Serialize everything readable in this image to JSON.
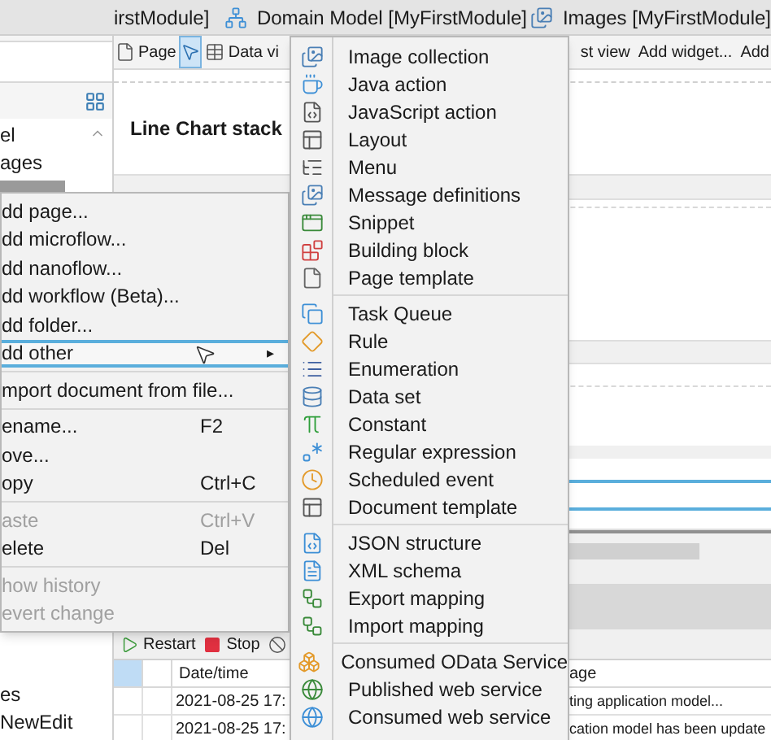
{
  "tabs": [
    {
      "label": "irstModule]",
      "kind": "page",
      "selected": false
    },
    {
      "label": "Domain Model [MyFirstModule]",
      "kind": "domain_model",
      "selected": false
    },
    {
      "label": "Images [MyFirstModule]",
      "kind": "images",
      "selected": false
    }
  ],
  "sidebar": {
    "items": [
      "el",
      "ages"
    ],
    "bottom_items": [
      "es",
      "NewEdit"
    ]
  },
  "toolbar": {
    "items": [
      {
        "label": "Page",
        "kind": "page",
        "selected": false
      },
      {
        "kind": "pointer",
        "selected": true
      },
      {
        "label": "Data vi",
        "kind": "data_view",
        "selected": false
      },
      {
        "label": "st view",
        "kind": "text",
        "selected": false
      },
      {
        "label": "Add widget...",
        "kind": "text",
        "selected": false
      },
      {
        "label": "Add",
        "kind": "text",
        "selected": false
      }
    ]
  },
  "canvas": {
    "heading": "Line Chart stack"
  },
  "context_menu": {
    "items": [
      {
        "kind": "item",
        "label": "dd page...",
        "disabled": false,
        "highlighted": false
      },
      {
        "kind": "item",
        "label": "dd microflow...",
        "disabled": false,
        "highlighted": false
      },
      {
        "kind": "item",
        "label": "dd nanoflow...",
        "disabled": false,
        "highlighted": false
      },
      {
        "kind": "item",
        "label": "dd workflow (Beta)...",
        "disabled": false,
        "highlighted": false
      },
      {
        "kind": "item",
        "label": "dd folder...",
        "disabled": false,
        "highlighted": false
      },
      {
        "kind": "submenu",
        "label": "dd other",
        "arrow": "▸",
        "disabled": false,
        "highlighted": true
      },
      {
        "kind": "separator"
      },
      {
        "kind": "item",
        "label": "mport document from file...",
        "disabled": false,
        "highlighted": false
      },
      {
        "kind": "separator"
      },
      {
        "kind": "item",
        "label": "ename...",
        "shortcut": "F2",
        "disabled": false,
        "highlighted": false
      },
      {
        "kind": "item",
        "label": "ove...",
        "disabled": false,
        "highlighted": false
      },
      {
        "kind": "item",
        "label": "opy",
        "shortcut": "Ctrl+C",
        "disabled": false,
        "highlighted": false
      },
      {
        "kind": "separator"
      },
      {
        "kind": "item",
        "label": "aste",
        "shortcut": "Ctrl+V",
        "disabled": true,
        "highlighted": false
      },
      {
        "kind": "item",
        "label": "elete",
        "shortcut": "Del",
        "disabled": false,
        "highlighted": false
      },
      {
        "kind": "separator"
      },
      {
        "kind": "item",
        "label": "how history",
        "disabled": true,
        "highlighted": false
      },
      {
        "kind": "item",
        "label": "evert change",
        "disabled": true,
        "highlighted": false
      }
    ]
  },
  "submenu": {
    "groups": [
      [
        {
          "label": "Image collection",
          "kind": "image_collection"
        },
        {
          "label": "Java action",
          "kind": "java_action"
        },
        {
          "label": "JavaScript action",
          "kind": "javascript_action"
        },
        {
          "label": "Layout",
          "kind": "layout"
        },
        {
          "label": "Menu",
          "kind": "menu"
        },
        {
          "label": "Message definitions",
          "kind": "message_definitions"
        },
        {
          "label": "Snippet",
          "kind": "snippet"
        },
        {
          "label": "Building block",
          "kind": "building_block"
        },
        {
          "label": "Page template",
          "kind": "page_template"
        }
      ],
      [
        {
          "label": "Task Queue",
          "kind": "task_queue"
        },
        {
          "label": "Rule",
          "kind": "rule"
        },
        {
          "label": "Enumeration",
          "kind": "enumeration"
        },
        {
          "label": "Data set",
          "kind": "data_set"
        },
        {
          "label": "Constant",
          "kind": "constant"
        },
        {
          "label": "Regular expression",
          "kind": "regular_expression"
        },
        {
          "label": "Scheduled event",
          "kind": "scheduled_event"
        },
        {
          "label": "Document template",
          "kind": "document_template"
        }
      ],
      [
        {
          "label": "JSON structure",
          "kind": "json_structure"
        },
        {
          "label": "XML schema",
          "kind": "xml_schema"
        },
        {
          "label": "Export mapping",
          "kind": "export_mapping"
        },
        {
          "label": "Import mapping",
          "kind": "import_mapping"
        }
      ],
      [
        {
          "label": "Consumed OData Service",
          "kind": "odata"
        },
        {
          "label": "Published web service",
          "kind": "published_web_service"
        },
        {
          "label": "Consumed web service",
          "kind": "consumed_web_service"
        }
      ]
    ]
  },
  "console": {
    "buttons": [
      {
        "label": "Restart",
        "kind": "restart"
      },
      {
        "label": "Stop",
        "kind": "stop"
      },
      {
        "kind": "clear"
      }
    ],
    "columns": [
      {
        "label": "Date/time"
      },
      {
        "label": "age"
      }
    ],
    "rows": [
      {
        "date": "2021-08-25 17:",
        "message": "ting application model..."
      },
      {
        "date": "2021-08-25 17:",
        "message": "cation model has been update"
      }
    ]
  }
}
